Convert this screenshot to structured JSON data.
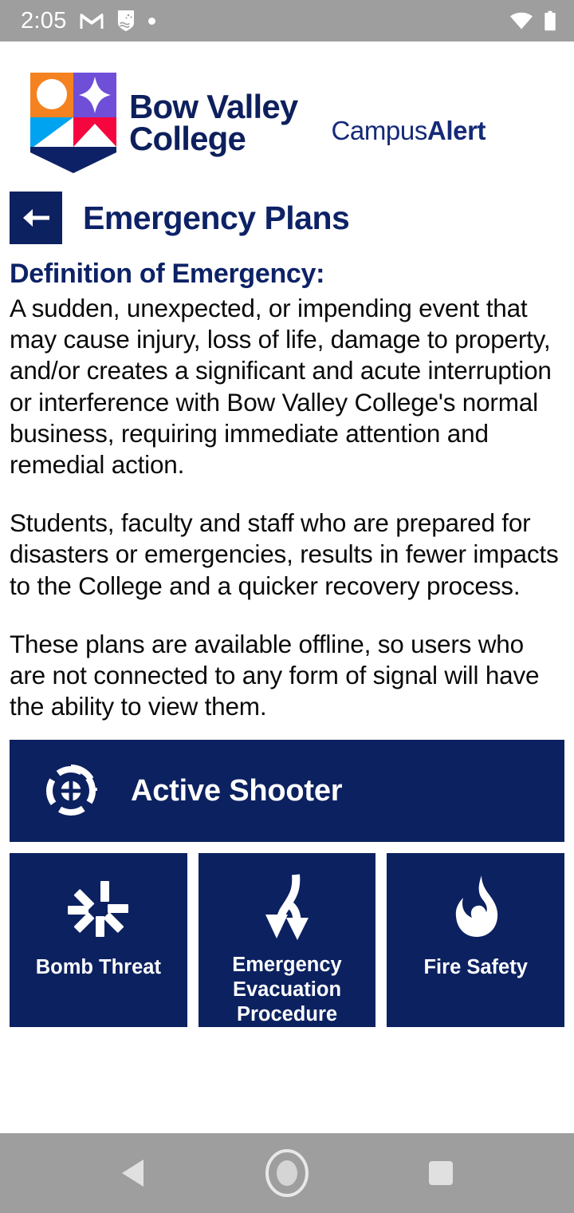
{
  "status_bar": {
    "time": "2:05",
    "icons": [
      "gmail-icon",
      "app-shield-icon",
      "notification-dot-icon"
    ],
    "right_icons": [
      "wifi-icon",
      "battery-icon"
    ],
    "background": "#9e9e9e"
  },
  "brand": {
    "logo_line1": "Bow Valley",
    "logo_line2": "College",
    "logo_alt": "bow-valley-college-shield-logo",
    "app_name_regular": "Campus",
    "app_name_bold": "Alert",
    "navy": "#0c2160",
    "shield_colors": {
      "orange": "#f58220",
      "purple": "#6f4fd8",
      "cyan": "#00a3ef",
      "crimson": "#f5063f",
      "navy": "#0d2266"
    }
  },
  "page": {
    "back_label": "back-arrow",
    "title": "Emergency Plans"
  },
  "body": {
    "heading": "Definition of Emergency:",
    "paragraphs": [
      "A sudden, unexpected, or impending event that may cause injury, loss of life, damage to property, and/or creates a significant and acute interruption or interference with Bow Valley College's normal business, requiring immediate attention and remedial action.",
      "Students, faculty and staff who are prepared for disasters or emergencies, results in fewer impacts to the College and a quicker recovery process.",
      "These plans are available offline, so users who are not connected to any form of signal will have the ability to view them."
    ]
  },
  "banner": {
    "label": "Active Shooter",
    "icon": "crosshair-target-icon"
  },
  "tiles": [
    {
      "label": "Bomb Threat",
      "icon": "explosion-burst-icon"
    },
    {
      "label": "Emergency Evacuation Procedure",
      "icon": "split-arrows-down-icon"
    },
    {
      "label": "Fire Safety",
      "icon": "flame-icon"
    }
  ],
  "nav_bar": {
    "back": "back-triangle-icon",
    "home": "home-circle-icon",
    "recents": "recents-square-icon",
    "background": "#9e9e9e"
  }
}
